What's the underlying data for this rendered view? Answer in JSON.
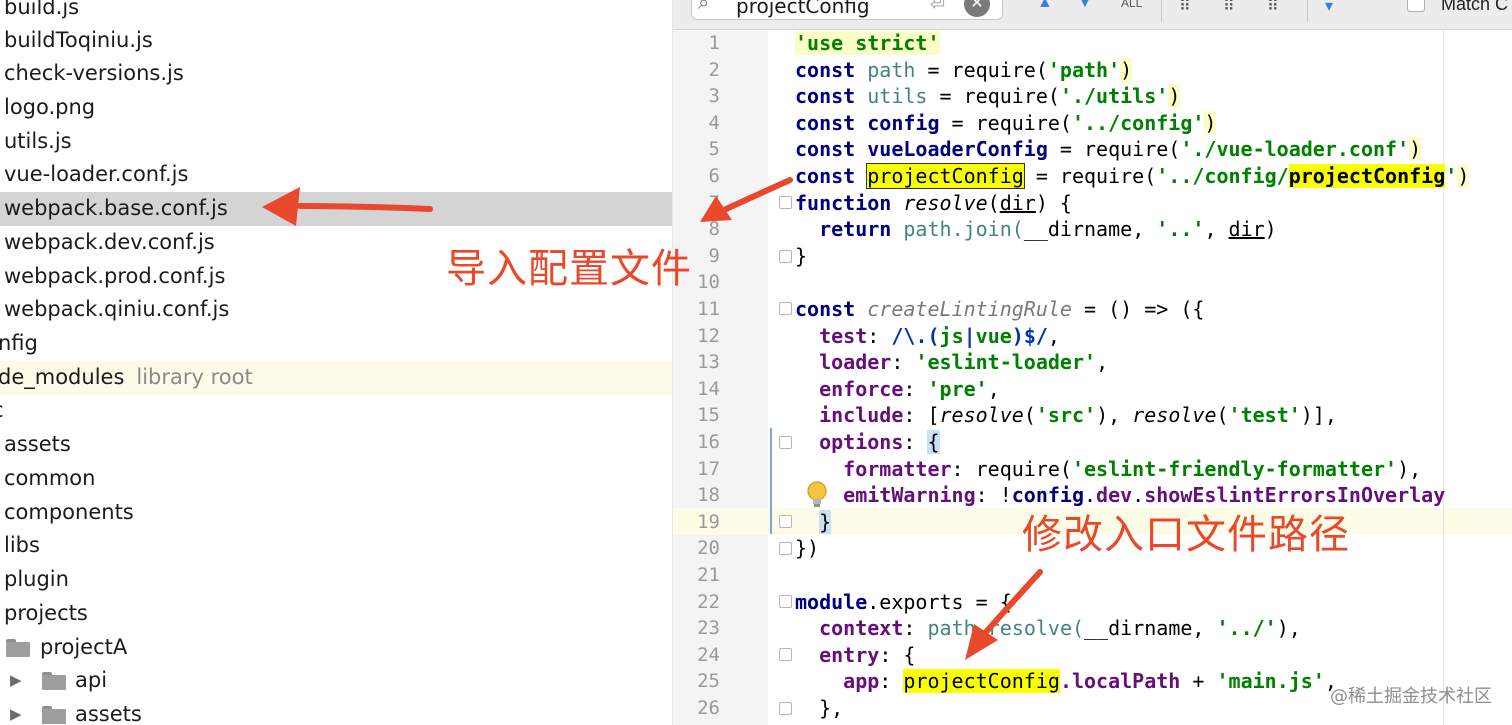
{
  "tree": {
    "files": [
      {
        "label": "build.js",
        "kind": "file"
      },
      {
        "label": "buildToqiniu.js",
        "kind": "file"
      },
      {
        "label": "check-versions.js",
        "kind": "file"
      },
      {
        "label": "logo.png",
        "kind": "file"
      },
      {
        "label": "utils.js",
        "kind": "file"
      },
      {
        "label": "vue-loader.conf.js",
        "kind": "file"
      },
      {
        "label": "webpack.base.conf.js",
        "kind": "file",
        "selected": true
      },
      {
        "label": "webpack.dev.conf.js",
        "kind": "file"
      },
      {
        "label": "webpack.prod.conf.js",
        "kind": "file"
      },
      {
        "label": "webpack.qiniu.conf.js",
        "kind": "file"
      },
      {
        "label": "nfig",
        "kind": "folder"
      },
      {
        "label": "de_modules",
        "hint": "library root",
        "kind": "folder"
      },
      {
        "label": "c",
        "kind": "folder"
      },
      {
        "label": "assets",
        "kind": "folder"
      },
      {
        "label": "common",
        "kind": "folder"
      },
      {
        "label": "components",
        "kind": "folder"
      },
      {
        "label": "libs",
        "kind": "folder"
      },
      {
        "label": "plugin",
        "kind": "folder"
      },
      {
        "label": "projects",
        "kind": "folder"
      },
      {
        "label": "projectA",
        "kind": "folder"
      },
      {
        "label": "api",
        "kind": "folder"
      },
      {
        "label": "assets",
        "kind": "folder"
      }
    ]
  },
  "search": {
    "query": "projectConfig",
    "match_case_label": "Match C"
  },
  "editor": {
    "line_numbers": [
      "1",
      "2",
      "3",
      "4",
      "5",
      "6",
      "7",
      "8",
      "9",
      "10",
      "11",
      "12",
      "13",
      "14",
      "15",
      "16",
      "17",
      "18",
      "19",
      "20",
      "21",
      "22",
      "23",
      "24",
      "25",
      "26"
    ],
    "current_line": "19"
  },
  "code": {
    "l1": {
      "s": "'use strict'"
    },
    "l2": {
      "kw": "const",
      "id": "path",
      "eq": " = require(",
      "s": "'path'",
      "close": ")"
    },
    "l3": {
      "kw": "const",
      "id": "utils",
      "eq": " = require(",
      "s": "'./utils'",
      "close": ")"
    },
    "l4": {
      "kw": "const",
      "id": "config",
      "eq": " = require(",
      "s": "'../config'",
      "close": ")"
    },
    "l5": {
      "kw": "const",
      "id": "vueLoaderConfig",
      "eq": " = require(",
      "s": "'./vue-loader.conf'",
      "close": ")"
    },
    "l6": {
      "kw": "const",
      "id": "projectConfig",
      "eq": " = require(",
      "s1": "'../config/",
      "s2": "projectConfig",
      "s3": "'",
      "close": ")"
    },
    "l7": {
      "kw": "function",
      "fn": "resolve",
      "open": "(",
      "arg": "dir",
      "rest": ") {"
    },
    "l8": {
      "kw": "return",
      "obj": "path",
      "call": ".join(",
      "a1": "__dirname",
      "c1": ", ",
      "s": "'..'",
      "c2": ", ",
      "a2": "dir",
      "close": ")"
    },
    "l9": {
      "t": "}"
    },
    "l11": {
      "kw": "const",
      "fn": "createLintingRule",
      "rest": " = () => ({"
    },
    "l12": {
      "p": "test",
      "c": ": ",
      "rx1": "/\\.(",
      "rx2": "js",
      "rx3": "|",
      "rx4": "vue",
      "rx5": ")$/",
      "end": ","
    },
    "l13": {
      "p": "loader",
      "c": ": ",
      "s": "'eslint-loader'",
      "end": ","
    },
    "l14": {
      "p": "enforce",
      "c": ": ",
      "s": "'pre'",
      "end": ","
    },
    "l15": {
      "p": "include",
      "c": ": [",
      "f1": "resolve",
      "o1": "(",
      "s1": "'src'",
      "m": "), ",
      "f2": "resolve",
      "o2": "(",
      "s2": "'test'",
      "end": ")],"
    },
    "l16": {
      "p": "options",
      "c": ": ",
      "b": "{"
    },
    "l17": {
      "p": "formatter",
      "c": ": require(",
      "s": "'eslint-friendly-formatter'",
      "end": "),"
    },
    "l18": {
      "p": "emitWarning",
      "c": ": !",
      "o": "config",
      "d1": ".",
      "p2": "dev",
      "d2": ".",
      "p3": "showEslintErrorsInOverlay"
    },
    "l19": {
      "t": "}"
    },
    "l20": {
      "t": "})"
    },
    "l22": {
      "kw": "module",
      "rest": ".exports = {"
    },
    "l23": {
      "p": "context",
      "c": ": ",
      "o": "path",
      "call": ".resolve(",
      "a": "__dirname",
      "cm": ", ",
      "s": "'../'",
      "end": "),"
    },
    "l24": {
      "p": "entry",
      "c": ": {"
    },
    "l25": {
      "p": "app",
      "c": ": ",
      "hl": "projectConfig",
      "p2": ".localPath",
      "op": " + ",
      "s": "'main.js'",
      "end": ","
    },
    "l26": {
      "t": "},"
    }
  },
  "annotations": {
    "import_config": "导入配置文件",
    "modify_entry": "修改入口文件路径",
    "color": "#e8482b"
  },
  "watermark": "@稀土掘金技术社区"
}
